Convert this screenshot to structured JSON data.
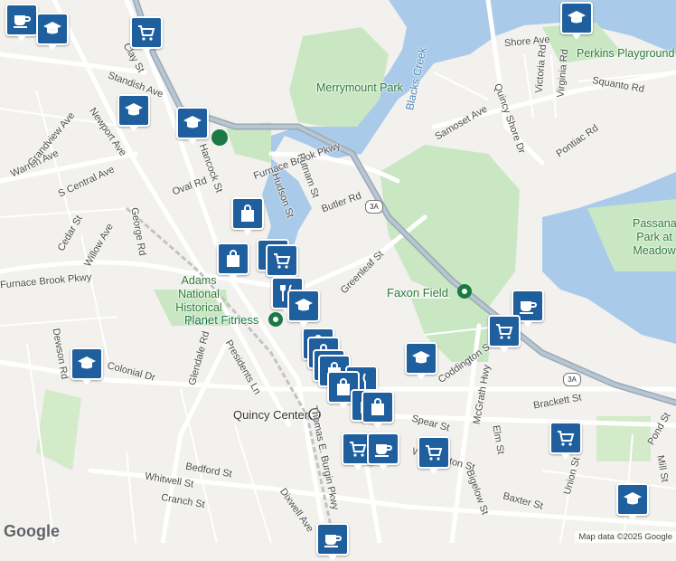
{
  "map": {
    "streets": [
      "Hancock St",
      "Newport Ave",
      "Furnace Brook Pkwy",
      "Putnam St",
      "Hudson St",
      "Butler Rd",
      "Greenleaf St",
      "Presidents Ln",
      "Glendale Rd",
      "Colonial Dr",
      "Dewson Rd",
      "Cedar St",
      "Willow Ave",
      "George Rd",
      "S Central Ave",
      "Warren Ave",
      "Grandview Ave",
      "Clay St",
      "Standish Ave",
      "Oval Rd",
      "Thomas E. Burgin Pkwy",
      "Whitwell St",
      "Bedford St",
      "Cranch St",
      "Dixwell Ave",
      "Spear St",
      "Washington St",
      "McGrath Hwy",
      "Coddington St",
      "Brackett St",
      "Elm St",
      "Baxter St",
      "Union St",
      "Bigelow St",
      "Pond St",
      "Mill St",
      "Shore Ave",
      "Victoria Rd",
      "Virginia Rd",
      "Squanto Rd",
      "Samoset Ave",
      "Quincy Shore Dr",
      "Pontiac Rd"
    ],
    "parks": [
      "Merrymount Park",
      "Perkins Playground",
      "Adams National Historical Park",
      "Faxon Field",
      "Passanault Park at Meadow"
    ],
    "waterways": [
      "Blacks Creek"
    ],
    "places": [
      "Quincy Center",
      "Planet Fitness"
    ],
    "route_shields": [
      "3A",
      "3A"
    ],
    "attribution": "Map data ©2025 Google",
    "logo": "Google",
    "colors": {
      "water": "#a9cbe9",
      "park": "#c9e7c2",
      "road": "#ffffff",
      "highway": "#9aa9b7",
      "pin": "#1f5f9e"
    }
  },
  "pins": [
    {
      "type": "cafe"
    },
    {
      "type": "school"
    },
    {
      "type": "grocery"
    },
    {
      "type": "school"
    },
    {
      "type": "school"
    },
    {
      "type": "school"
    },
    {
      "type": "shopping"
    },
    {
      "type": "shopping"
    },
    {
      "type": "restaurant"
    },
    {
      "type": "grocery"
    },
    {
      "type": "restaurant"
    },
    {
      "type": "school"
    },
    {
      "type": "school"
    },
    {
      "type": "shopping"
    },
    {
      "type": "shopping"
    },
    {
      "type": "shopping"
    },
    {
      "type": "shopping"
    },
    {
      "type": "restaurant"
    },
    {
      "type": "shopping"
    },
    {
      "type": "shopping"
    },
    {
      "type": "shopping"
    },
    {
      "type": "grocery"
    },
    {
      "type": "cafe"
    },
    {
      "type": "grocery"
    },
    {
      "type": "school"
    },
    {
      "type": "cafe"
    },
    {
      "type": "grocery"
    },
    {
      "type": "grocery"
    },
    {
      "type": "school"
    },
    {
      "type": "cafe"
    }
  ]
}
